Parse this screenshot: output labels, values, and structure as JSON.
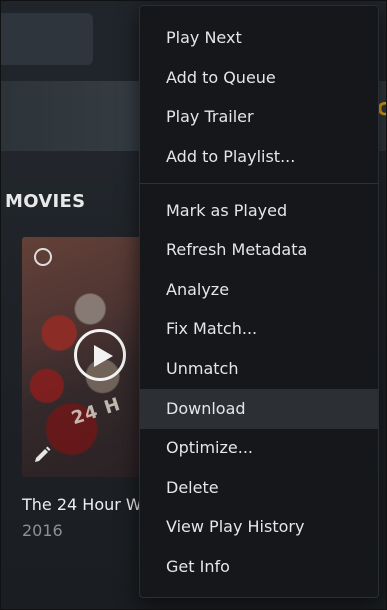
{
  "section_title": "MOVIES",
  "hero_accent": "C",
  "movie": {
    "title": "The 24 Hour W",
    "year": "2016",
    "poster_text": "24 H"
  },
  "menu": {
    "group1": [
      "Play Next",
      "Add to Queue",
      "Play Trailer",
      "Add to Playlist..."
    ],
    "group2": [
      "Mark as Played",
      "Refresh Metadata",
      "Analyze",
      "Fix Match...",
      "Unmatch",
      "Download",
      "Optimize...",
      "Delete",
      "View Play History",
      "Get Info"
    ],
    "highlighted": "Download"
  },
  "colors": {
    "accent": "#e5a00d",
    "menu_bg": "#15171a",
    "menu_highlight": "#2c3035"
  },
  "icons": [
    "select-circle-icon",
    "play-icon",
    "pencil-edit-icon"
  ]
}
